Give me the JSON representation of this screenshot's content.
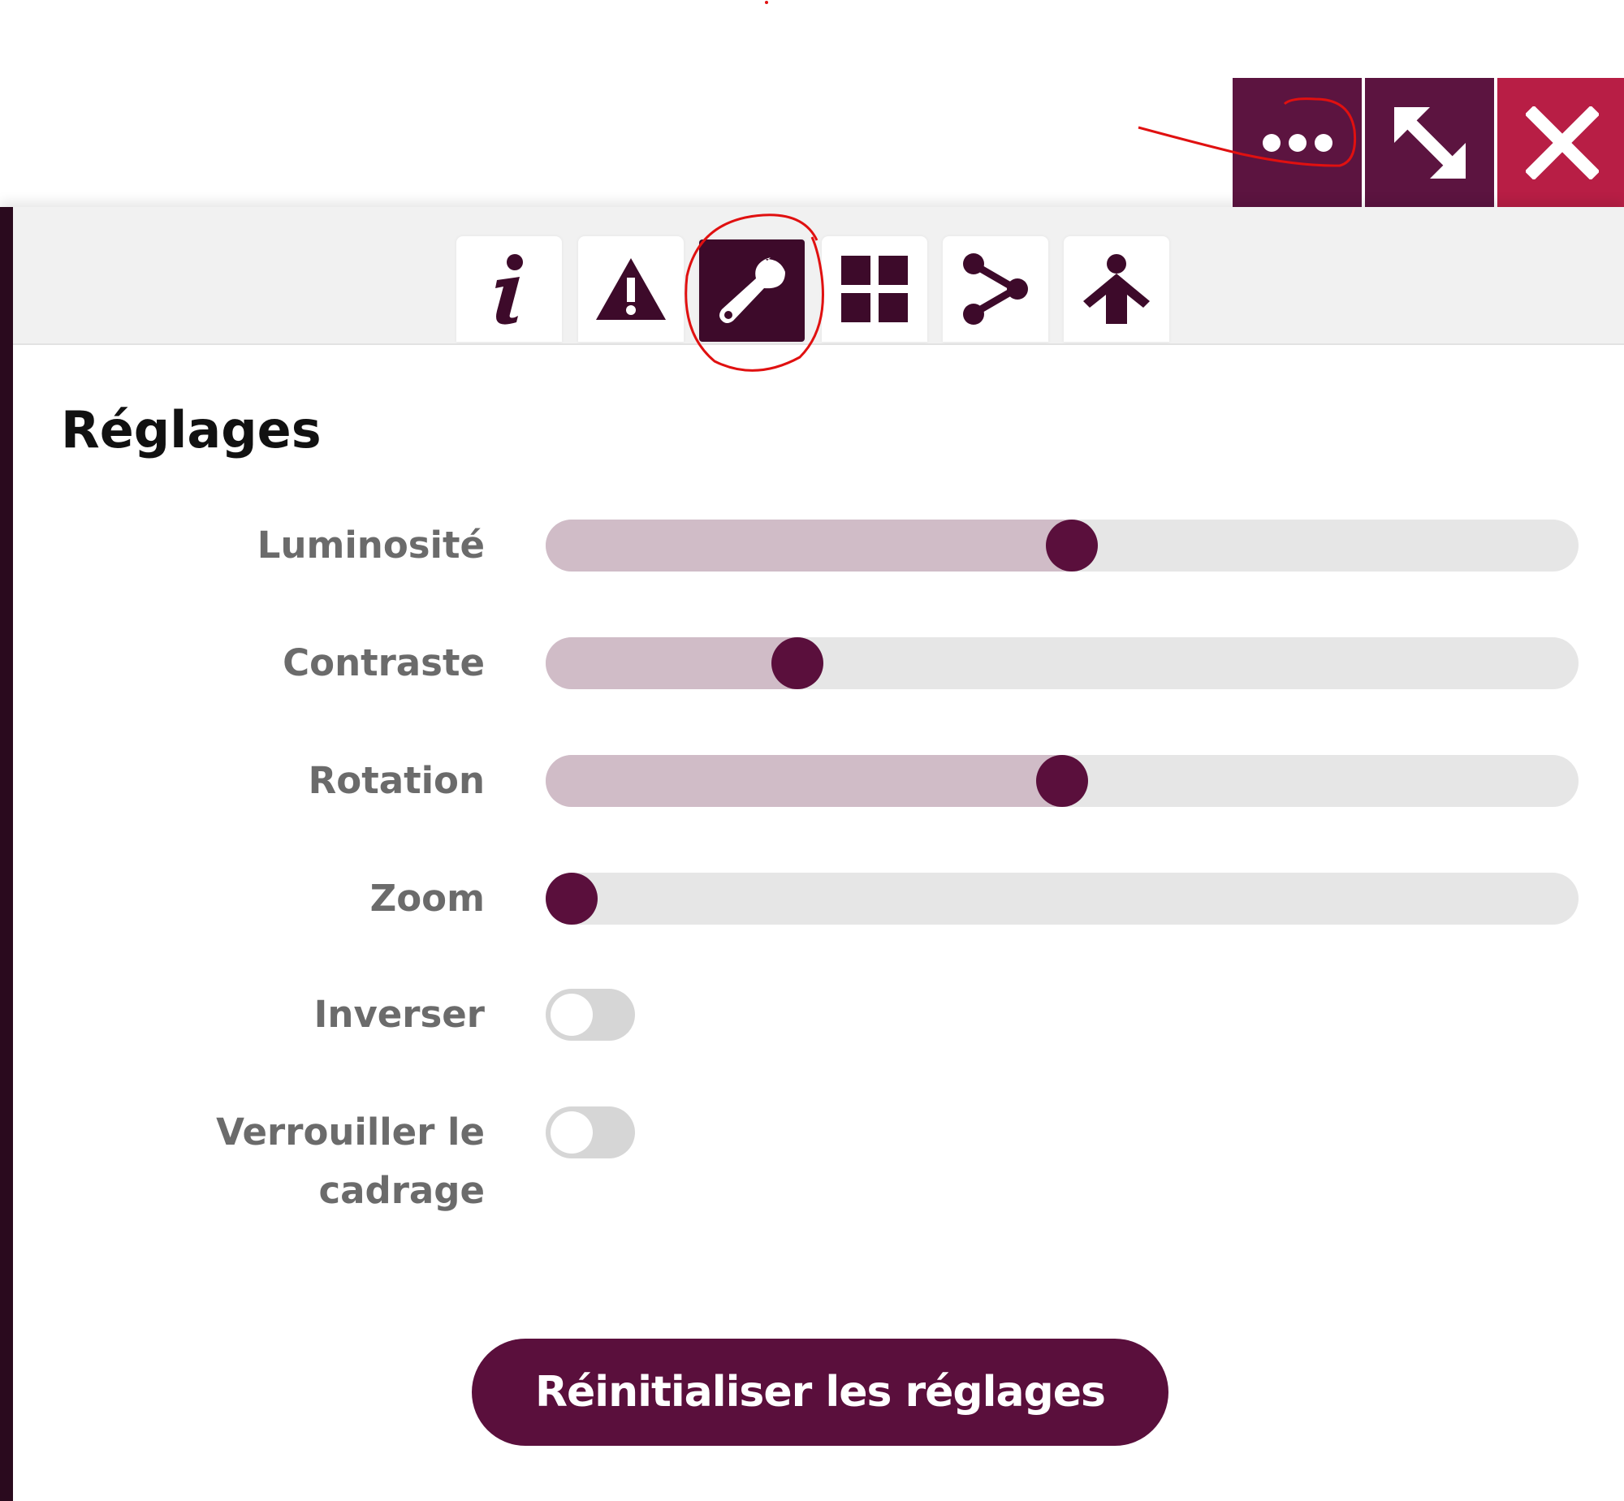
{
  "window_controls": [
    {
      "name": "more-options",
      "icon": "ellipsis-icon"
    },
    {
      "name": "expand",
      "icon": "expand-arrows-icon"
    },
    {
      "name": "close",
      "icon": "close-icon"
    }
  ],
  "tabs": [
    {
      "name": "info",
      "icon": "info-icon",
      "active": false
    },
    {
      "name": "warning",
      "icon": "warning-icon",
      "active": false
    },
    {
      "name": "settings",
      "icon": "wrench-icon",
      "active": true
    },
    {
      "name": "grid",
      "icon": "grid-icon",
      "active": false
    },
    {
      "name": "share",
      "icon": "share-icon",
      "active": false
    },
    {
      "name": "accessibility",
      "icon": "person-icon",
      "active": false
    }
  ],
  "settings": {
    "title": "Réglages",
    "sliders": [
      {
        "label": "Luminosité",
        "value_pct": 51
      },
      {
        "label": "Contraste",
        "value_pct": 23
      },
      {
        "label": "Rotation",
        "value_pct": 50
      },
      {
        "label": "Zoom",
        "value_pct": 0
      }
    ],
    "toggles": [
      {
        "label": "Inverser",
        "on": false
      },
      {
        "label_line1": "Verrouiller le",
        "label_line2": "cadrage",
        "on": false
      }
    ],
    "reset_label": "Réinitialiser les réglages"
  },
  "colors": {
    "accent": "#5a0f3c",
    "close": "#b81e45",
    "slider_fill": "#d0bcc7",
    "track": "#e6e6e6",
    "annotation": "#e01010"
  }
}
